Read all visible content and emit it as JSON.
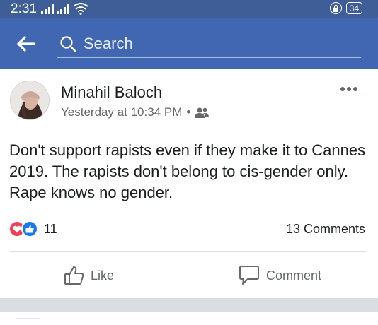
{
  "status_bar": {
    "time": "2:31",
    "battery": "34"
  },
  "header": {
    "search_placeholder": "Search"
  },
  "post": {
    "author": "Minahil Baloch",
    "timestamp": "Yesterday at 10:34 PM",
    "separator": "•",
    "text": "Don't support rapists even if they make it to Cannes 2019. The rapists don't belong to cis-gender only. Rape knows no gender.",
    "reaction_count": "11",
    "comments_count": "13 Comments",
    "actions": {
      "like": "Like",
      "comment": "Comment"
    }
  },
  "icons": {
    "back": "back-arrow-icon",
    "search": "search-icon",
    "more": "more-options-icon",
    "audience": "friends-icon",
    "like": "thumbs-up-icon",
    "comment": "comment-bubble-icon"
  },
  "colors": {
    "header": "#4267b2",
    "status_bar": "#3f5d96",
    "love": "#f33e58",
    "like": "#1877f2"
  }
}
